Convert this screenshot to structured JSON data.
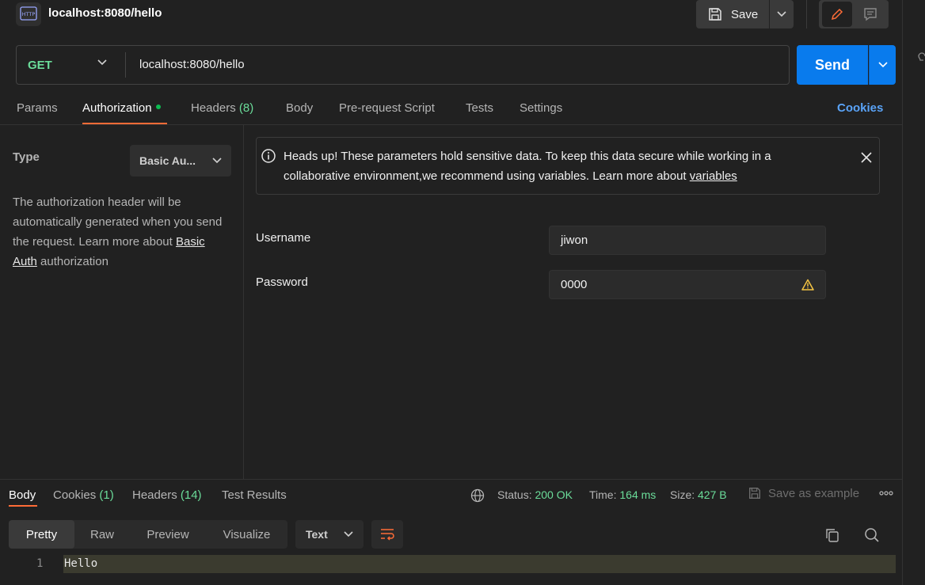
{
  "header": {
    "title": "localhost:8080/hello",
    "icon_label": "HTTP",
    "save_label": "Save"
  },
  "request": {
    "method": "GET",
    "url": "localhost:8080/hello",
    "send_label": "Send",
    "tabs": [
      {
        "label": "Params"
      },
      {
        "label": "Authorization"
      },
      {
        "label": "Headers",
        "count": "(8)"
      },
      {
        "label": "Body"
      },
      {
        "label": "Pre-request Script"
      },
      {
        "label": "Tests"
      },
      {
        "label": "Settings"
      }
    ],
    "active_tab": "Authorization",
    "cookies_label": "Cookies"
  },
  "auth": {
    "type_label": "Type",
    "type_value": "Basic Au...",
    "desc_text": "The authorization header will be automatically generated when you send the request. Learn more about",
    "desc_link": "Basic Auth",
    "desc_suffix": "authorization",
    "alert_text": "Heads up! These parameters hold sensitive data. To keep this data secure while working in a collaborative environment,we recommend using variables. Learn more about",
    "alert_link": "variables",
    "username_label": "Username",
    "username_value": "jiwon",
    "password_label": "Password",
    "password_value": "0000"
  },
  "response": {
    "tabs": [
      {
        "label": "Body"
      },
      {
        "label": "Cookies",
        "count": "(1)"
      },
      {
        "label": "Headers",
        "count": "(14)"
      },
      {
        "label": "Test Results"
      }
    ],
    "status_label": "Status:",
    "status_value": "200 OK",
    "time_label": "Time:",
    "time_value": "164 ms",
    "size_label": "Size:",
    "size_value": "427 B",
    "save_example_label": "Save as example",
    "formats": [
      "Pretty",
      "Raw",
      "Preview",
      "Visualize"
    ],
    "active_format": "Pretty",
    "text_type": "Text",
    "lines": [
      {
        "no": "1",
        "text": "Hello"
      }
    ]
  },
  "colors": {
    "accent_orange": "#ff6c37",
    "send_blue": "#097bed",
    "success_green": "#6bdd9a",
    "link_blue": "#5aa3f7",
    "warning_yellow": "#f5c443"
  }
}
